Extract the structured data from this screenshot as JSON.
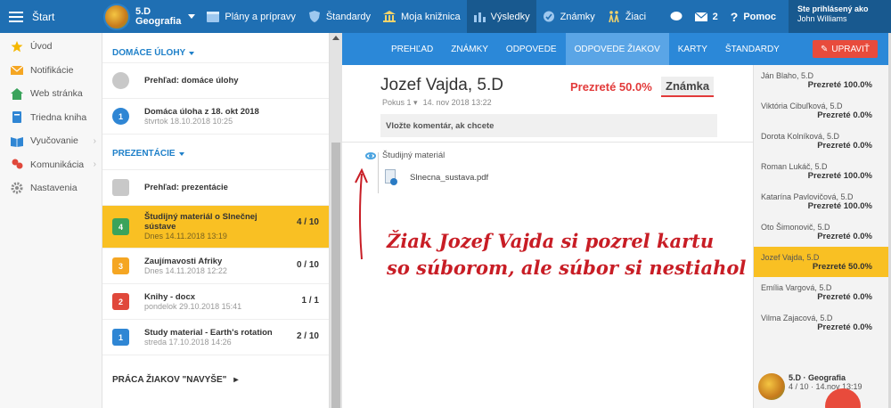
{
  "topbar": {
    "start": "Štart",
    "class_name": "5.D",
    "class_subject": "Geografia",
    "nav": [
      {
        "label": "Plány a prípravy",
        "icon": "calendar-icon"
      },
      {
        "label": "Štandardy",
        "icon": "shield-icon"
      },
      {
        "label": "Moja knižnica",
        "icon": "library-icon"
      },
      {
        "label": "Výsledky",
        "icon": "chart-icon"
      },
      {
        "label": "Známky",
        "icon": "grades-icon"
      },
      {
        "label": "Žiaci",
        "icon": "students-icon"
      }
    ],
    "messages_count": "2",
    "help": "Pomoc",
    "logged_label": "Ste prihlásený ako",
    "user_name": "John Williams"
  },
  "sidebar": {
    "items": [
      {
        "label": "Úvod",
        "color": "#f5b700"
      },
      {
        "label": "Notifikácie",
        "color": "#f5a623"
      },
      {
        "label": "Web stránka",
        "color": "#3aa35b"
      },
      {
        "label": "Triedna kniha",
        "color": "#2f86d4"
      },
      {
        "label": "Vyučovanie",
        "color": "#2f86d4"
      },
      {
        "label": "Komunikácia",
        "color": "#e0483b"
      },
      {
        "label": "Nastavenia",
        "color": "#8a8a8a"
      }
    ]
  },
  "list": {
    "homework_header": "DOMÁCE ÚLOHY",
    "homework_overview": "Prehľad: domáce úlohy",
    "homework_item": {
      "title": "Domáca úloha z 18. okt 2018",
      "sub": "štvrtok 18.10.2018 10:25",
      "num": "1"
    },
    "presentations_header": "PREZENTÁCIE",
    "presentations_overview": "Prehľad: prezentácie",
    "presentations": [
      {
        "num": "4",
        "title": "Študijný materiál o Slnečnej sústave",
        "sub": "Dnes 14.11.2018 13:19",
        "count": "4 / 10",
        "color": "#3aa35b"
      },
      {
        "num": "3",
        "title": "Zaujímavosti Afriky",
        "sub": "Dnes 14.11.2018 12:22",
        "count": "0 / 10",
        "color": "#f5a623"
      },
      {
        "num": "2",
        "title": "Knihy - docx",
        "sub": "pondelok 29.10.2018 15:41",
        "count": "1 / 1",
        "color": "#e0483b"
      },
      {
        "num": "1",
        "title": "Study material - Earth's rotation",
        "sub": "streda 17.10.2018 14:26",
        "count": "2 / 10",
        "color": "#2f86d4"
      }
    ],
    "extra_header": "PRÁCA ŽIAKOV \"NAVYŠE\""
  },
  "tabs": [
    "PREHĽAD",
    "ZNÁMKY",
    "ODPOVEDE",
    "ODPOVEDE ŽIAKOV",
    "KARTY",
    "ŠTANDARDY"
  ],
  "edit_button": "UPRAVIŤ",
  "detail": {
    "student": "Jozef Vajda, 5.D",
    "attempt": "Pokus 1",
    "date": "14. nov 2018 13:22",
    "viewed": "Prezreté 50.0%",
    "grade": "Známka",
    "comment_placeholder": "Vložte komentár, ak chcete",
    "material_label": "Študijný materiál",
    "file": "Slnecna_sustava.pdf",
    "annotation_line1": "Žiak Jozef Vajda si pozrel kartu",
    "annotation_line2": "so súborom, ale súbor si nestiahol"
  },
  "students": [
    {
      "name": "Ján Blaho, 5.D",
      "pct": "Prezreté 100.0%"
    },
    {
      "name": "Viktória Cibuľková, 5.D",
      "pct": "Prezreté 0.0%"
    },
    {
      "name": "Dorota Kolníková, 5.D",
      "pct": "Prezreté 0.0%"
    },
    {
      "name": "Roman Lukáč, 5.D",
      "pct": "Prezreté 100.0%"
    },
    {
      "name": "Katarína Pavlovičová, 5.D",
      "pct": "Prezreté 100.0%"
    },
    {
      "name": "Oto Šimonovič, 5.D",
      "pct": "Prezreté 0.0%"
    },
    {
      "name": "Jozef Vajda, 5.D",
      "pct": "Prezreté 50.0%"
    },
    {
      "name": "Emília Vargová, 5.D",
      "pct": "Prezreté 0.0%"
    },
    {
      "name": "Vilma Zajacová, 5.D",
      "pct": "Prezreté 0.0%"
    }
  ],
  "footer": {
    "title": "5.D · Geografia",
    "sub": "4 / 10 · 14.nov 13:19"
  }
}
